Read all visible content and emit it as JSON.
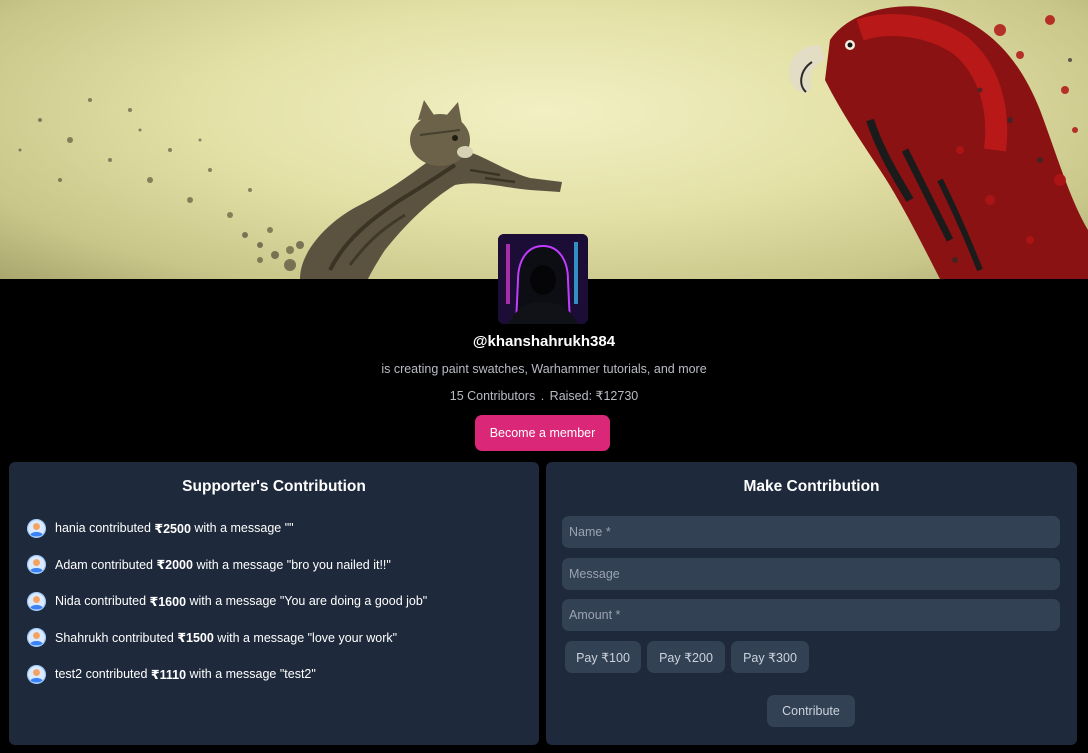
{
  "profile": {
    "username": "@khanshahrukh384",
    "tagline": "is creating paint swatches, Warhammer tutorials, and more",
    "contributors_text": "15 Contributors",
    "separator": ".",
    "raised_text": "Raised: ₹12730",
    "member_button": "Become a member"
  },
  "supporters": {
    "title": "Supporter's Contribution",
    "items": [
      {
        "name": "hania",
        "verb": " contributed ",
        "amount": "₹2500",
        "message": " with a message \"\""
      },
      {
        "name": "Adam",
        "verb": " contributed ",
        "amount": "₹2000",
        "message": " with a message \"bro you nailed it!!\""
      },
      {
        "name": "Nida",
        "verb": " contributed ",
        "amount": "₹1600",
        "message": " with a message \"You are doing a good job\""
      },
      {
        "name": "Shahrukh",
        "verb": " contributed ",
        "amount": "₹1500",
        "message": " with a message \"love your work\""
      },
      {
        "name": "test2",
        "verb": " contributed ",
        "amount": "₹1110",
        "message": " with a message \"test2\""
      }
    ]
  },
  "contribution_form": {
    "title": "Make Contribution",
    "name_placeholder": "Name *",
    "message_placeholder": "Message",
    "amount_placeholder": "Amount *",
    "pay_options": [
      "Pay ₹100",
      "Pay ₹200",
      "Pay ₹300"
    ],
    "submit_label": "Contribute"
  },
  "colors": {
    "page_background": "#000000",
    "panel_background": "#1e293b",
    "field_background": "#334155",
    "accent_pink": "#db2777"
  },
  "icons": {
    "supporter_avatar": "user-avatar-icon"
  }
}
